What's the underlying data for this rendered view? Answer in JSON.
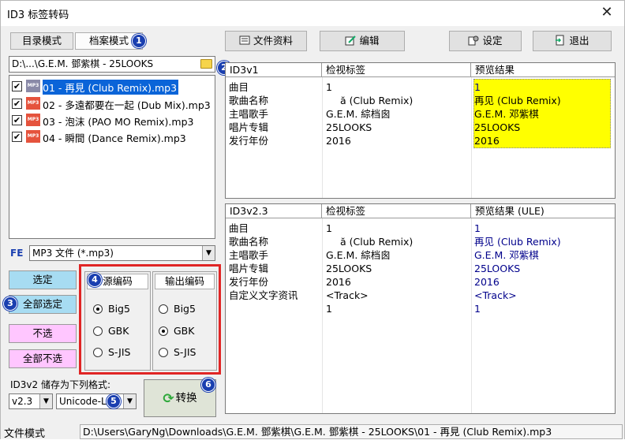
{
  "window": {
    "title": "ID3 标签转码",
    "close": "✕"
  },
  "tabs": [
    {
      "label": "目录模式"
    },
    {
      "label": "档案模式"
    }
  ],
  "toolbar": {
    "file_info": "文件资料",
    "edit": "编辑",
    "settings": "设定",
    "exit": "退出"
  },
  "badges": [
    "1",
    "2",
    "3",
    "4",
    "5",
    "6"
  ],
  "path": "D:\\...\\G.E.M. 鄧紫棋 - 25LOOKS",
  "files": [
    {
      "name": "01 - 再見 (Club Remix).mp3",
      "icon": "MP3",
      "checked": "✔"
    },
    {
      "name": "02 - 多遠都要在一起 (Dub Mix).mp3",
      "icon": "MP3",
      "checked": "✔"
    },
    {
      "name": "03 - 泡沫 (PAO MO Remix).mp3",
      "icon": "MP3",
      "checked": "✔"
    },
    {
      "name": "04 - 瞬間 (Dance Remix).mp3",
      "icon": "MP3",
      "checked": "✔"
    }
  ],
  "filter": {
    "label": "FE",
    "value": "MP3 文件 (*.mp3)"
  },
  "select_buttons": {
    "select": "选定",
    "select_all": "全部选定",
    "deselect": "不选",
    "deselect_all": "全部不选"
  },
  "encoding": {
    "source_header": "源编码",
    "output_header": "输出编码",
    "source_options": [
      "Big5",
      "GBK",
      "S-JIS"
    ],
    "output_options": [
      "Big5",
      "GBK",
      "S-JIS"
    ],
    "source_selected": "Big5",
    "output_selected": "GBK"
  },
  "store": {
    "label": "ID3v2 储存为下列格式:",
    "version": "v2.3",
    "format": "Unicode-L"
  },
  "convert_label": "转换",
  "id3v1": {
    "headers": [
      "ID3v1",
      "检视标签",
      "预览结果"
    ],
    "rows": [
      [
        "曲目",
        "1",
        "1"
      ],
      [
        "歌曲名称",
        "ă (Club Remix)",
        "再见 (Club Remix)"
      ],
      [
        "主唱歌手",
        "G.E.M. 綜档囪",
        "G.E.M. 邓紫棋"
      ],
      [
        "唱片专辑",
        "25LOOKS",
        "25LOOKS"
      ],
      [
        "发行年份",
        "2016",
        "2016"
      ]
    ]
  },
  "id3v2": {
    "headers": [
      "ID3v2.3",
      "检视标签",
      "预览结果 (ULE)"
    ],
    "rows": [
      [
        "曲目",
        "1",
        "1"
      ],
      [
        "歌曲名称",
        "ă (Club Remix)",
        "再见 (Club Remix)"
      ],
      [
        "主唱歌手",
        "G.E.M. 綜档囪",
        "G.E.M. 邓紫棋"
      ],
      [
        "唱片专辑",
        "25LOOKS",
        "25LOOKS"
      ],
      [
        "发行年份",
        "2016",
        "2016"
      ],
      [
        "自定义文字资讯",
        "<Track>",
        "<Track>"
      ],
      [
        "",
        "1",
        "1"
      ]
    ]
  },
  "status": {
    "mode": "文件模式",
    "path": "D:\\Users\\GaryNg\\Downloads\\G.E.M. 鄧紫棋\\G.E.M. 鄧紫棋 - 25LOOKS\\01 - 再見 (Club Remix).mp3"
  },
  "colors": {
    "badge": "#1a3fb0",
    "highlight": "#ffff00",
    "selection": "#0a64d8",
    "select_button": "#a7dcf2",
    "deselect_button": "#ffc6ff",
    "encoding_frame": "#e02525",
    "preview_text": "#00008b"
  }
}
